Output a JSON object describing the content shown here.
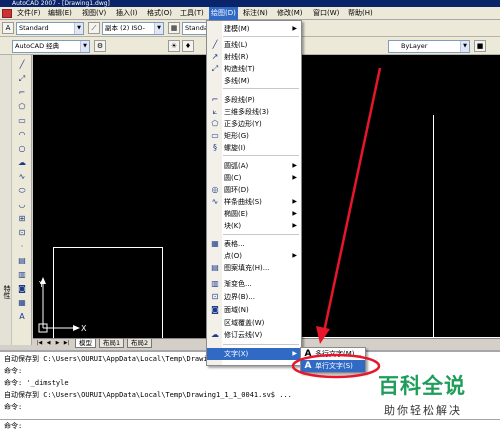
{
  "window": {
    "title": "AutoCAD 2007 - [Drawing1.dwg]"
  },
  "menubar": {
    "items": [
      {
        "label": "文件(F)"
      },
      {
        "label": "编辑(E)"
      },
      {
        "label": "视图(V)"
      },
      {
        "label": "插入(I)"
      },
      {
        "label": "格式(O)"
      },
      {
        "label": "工具(T)"
      },
      {
        "label": "绘图(D)"
      },
      {
        "label": "标注(N)"
      },
      {
        "label": "修改(M)"
      },
      {
        "label": "窗口(W)"
      },
      {
        "label": "帮助(H)"
      }
    ]
  },
  "toolbar": {
    "text_style": "Standard",
    "dim_style": "副本 (2) ISO-",
    "table_style": "Standard",
    "workspace": "AutoCAD 经典",
    "linetype": "ByLayer"
  },
  "left_palette": {
    "label": "特性"
  },
  "draw_menu": {
    "items": [
      {
        "label": "建模(M)",
        "icon": "none",
        "submenu": true
      },
      {
        "label": "直线(L)",
        "icon": "line-icon"
      },
      {
        "label": "射线(R)",
        "icon": "ray-icon"
      },
      {
        "label": "构造线(T)",
        "icon": "xline-icon"
      },
      {
        "label": "多线(M)",
        "icon": "none"
      },
      {
        "label": "多段线(P)",
        "icon": "polyline-icon"
      },
      {
        "label": "三维多段线(3)",
        "icon": "3dpolyline-icon"
      },
      {
        "label": "正多边形(Y)",
        "icon": "polygon-icon"
      },
      {
        "label": "矩形(G)",
        "icon": "rectangle-icon"
      },
      {
        "label": "螺旋(I)",
        "icon": "helix-icon"
      },
      {
        "label": "圆弧(A)",
        "icon": "none",
        "submenu": true
      },
      {
        "label": "圆(C)",
        "icon": "none",
        "submenu": true
      },
      {
        "label": "圆环(D)",
        "icon": "donut-icon"
      },
      {
        "label": "样条曲线(S)",
        "icon": "spline-icon"
      },
      {
        "label": "椭圆(E)",
        "icon": "none",
        "submenu": true
      },
      {
        "label": "块(K)",
        "icon": "none",
        "submenu": true
      },
      {
        "label": "表格...",
        "icon": "table-icon"
      },
      {
        "label": "点(O)",
        "icon": "none",
        "submenu": true
      },
      {
        "label": "图案填充(H)...",
        "icon": "hatch-icon"
      },
      {
        "label": "渐变色...",
        "icon": "gradient-icon"
      },
      {
        "label": "边界(B)...",
        "icon": "boundary-icon"
      },
      {
        "label": "面域(N)",
        "icon": "region-icon"
      },
      {
        "label": "区域覆盖(W)",
        "icon": "none"
      },
      {
        "label": "修订云线(V)",
        "icon": "revcloud-icon"
      },
      {
        "label": "文字(X)",
        "icon": "none",
        "submenu": true
      }
    ]
  },
  "text_submenu": {
    "items": [
      {
        "label": "多行文字(M)..."
      },
      {
        "label": "单行文字(S)"
      }
    ]
  },
  "layout_tabs": [
    {
      "label": "模型"
    },
    {
      "label": "布局1"
    },
    {
      "label": "布局2"
    }
  ],
  "command_history": [
    "自动保存到 C:\\Users\\OURUI\\AppData\\Local\\Temp\\Drawing1",
    "命令:",
    "命令: '_dimstyle",
    "自动保存到 C:\\Users\\OURUI\\AppData\\Local\\Temp\\Drawing1_1_1_0041.sv$ ...",
    "命令:"
  ],
  "command_prompt": "命令:",
  "watermark": {
    "title": "百科全说",
    "subtitle": "助你轻松解决"
  },
  "colors": {
    "menu_highlight": "#316ac5",
    "canvas": "#000000",
    "annotation_arrow": "#e8162a",
    "watermark_green": "#1e9e5a"
  }
}
